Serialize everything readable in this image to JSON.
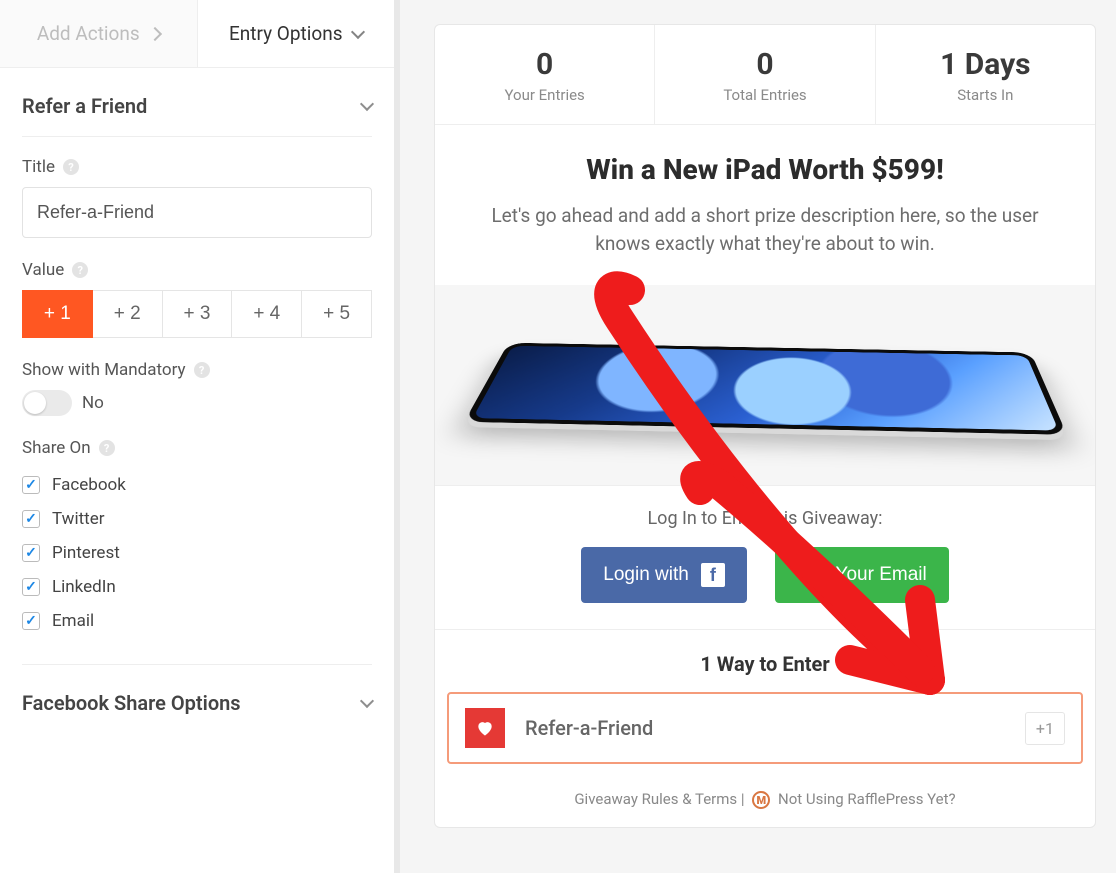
{
  "sidebar": {
    "tabs": {
      "add_actions": "Add Actions",
      "entry_options": "Entry Options"
    },
    "section_refer": "Refer a Friend",
    "title_label": "Title",
    "title_value": "Refer-a-Friend",
    "value_label": "Value",
    "value_options": [
      "+ 1",
      "+ 2",
      "+ 3",
      "+ 4",
      "+ 5"
    ],
    "value_selected_index": 0,
    "mandatory_label": "Show with Mandatory",
    "mandatory_state": "No",
    "share_on_label": "Share On",
    "share_on": [
      {
        "label": "Facebook",
        "checked": true
      },
      {
        "label": "Twitter",
        "checked": true
      },
      {
        "label": "Pinterest",
        "checked": true
      },
      {
        "label": "LinkedIn",
        "checked": true
      },
      {
        "label": "Email",
        "checked": true
      }
    ],
    "fb_share_options": "Facebook Share Options"
  },
  "preview": {
    "stats": [
      {
        "num": "0",
        "label": "Your Entries"
      },
      {
        "num": "0",
        "label": "Total Entries"
      },
      {
        "num": "1 Days",
        "label": "Starts In"
      }
    ],
    "headline": "Win a New iPad Worth $599!",
    "description": "Let's go ahead and add a short prize description here, so the user knows exactly what they're about to win.",
    "login_msg": "Log In to Enter this Giveaway:",
    "login_fb": "Login with",
    "login_email": "Use Your Email",
    "ways_heading": "1 Way to Enter",
    "entry": {
      "label": "Refer-a-Friend",
      "badge": "+1"
    },
    "footer": {
      "rules": "Giveaway Rules & Terms",
      "sep": "|",
      "promo": "Not Using RafflePress Yet?"
    }
  }
}
